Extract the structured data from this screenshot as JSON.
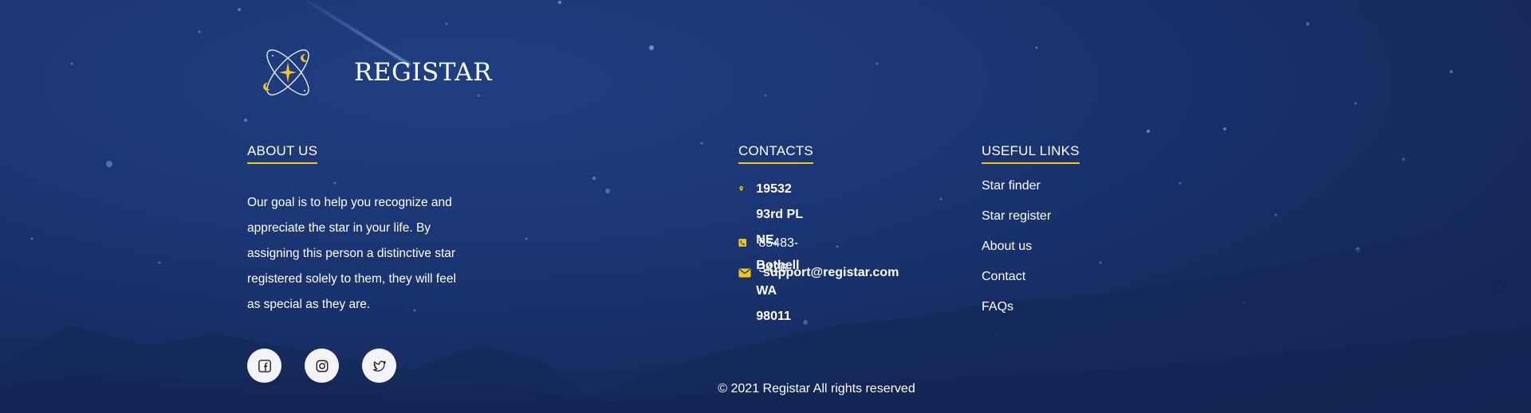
{
  "brand": {
    "name": "REGISTAR"
  },
  "colors": {
    "accent": "#f5c518",
    "background": "#1a3470",
    "text": "#ffffff"
  },
  "about": {
    "heading": "ABOUT US",
    "lines": [
      "Our goal is to help you recognize and",
      "appreciate the star in your life. By",
      "assigning this person a distinctive star",
      "registered solely to them, they will feel",
      "as special as they are."
    ]
  },
  "social": [
    {
      "name": "facebook",
      "icon": "facebook-icon"
    },
    {
      "name": "instagram",
      "icon": "instagram-icon"
    },
    {
      "name": "twitter",
      "icon": "twitter-icon"
    }
  ],
  "contacts": {
    "heading": "CONTACTS",
    "address_line1": "19532 93rd PL NE,",
    "address_line2": "Bothell WA 98011",
    "phone": "85483-3426",
    "email": "support@registar.com",
    "icons": [
      "map-pin-icon",
      "phone-icon",
      "mail-icon"
    ]
  },
  "useful_links": {
    "heading": "USEFUL LINKS",
    "items": [
      "Star finder",
      "Star register",
      "About us",
      "Contact",
      "FAQs"
    ]
  },
  "copyright": "© 2021 Registar All rights reserved"
}
